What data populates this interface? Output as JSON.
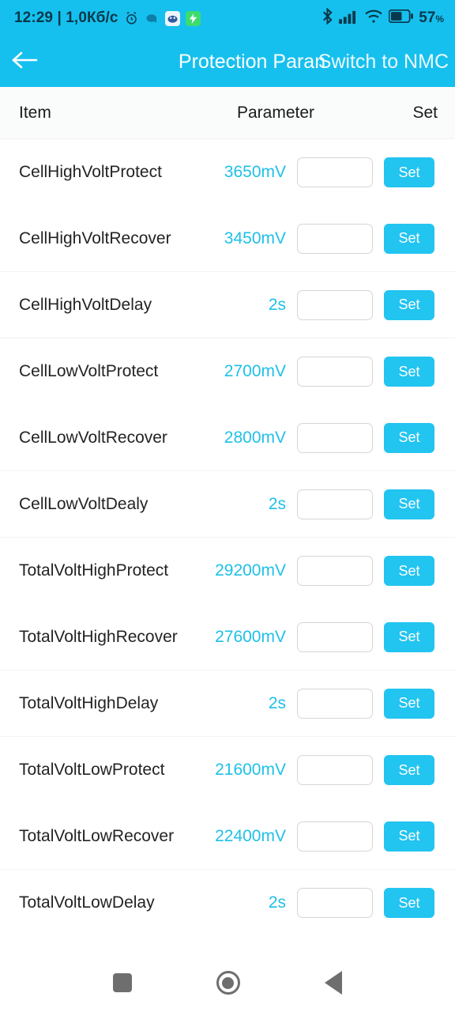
{
  "status_bar": {
    "clock": "12:29 | 1,0Кб/c",
    "battery_percent": "57",
    "percent_symbol": "%",
    "icons": [
      "alarm-clock-icon",
      "app-icon-elephant",
      "app-icon-blue",
      "charging-bolt-icon",
      "bluetooth-icon",
      "cellular-signal-icon",
      "wifi-icon",
      "battery-icon"
    ],
    "accent": "#16C0EE"
  },
  "title_bar": {
    "back_icon": "back-arrow-icon",
    "title": "Protection Paran",
    "overlay_title": "Switch to NMC"
  },
  "columns": {
    "item": "Item",
    "parameter": "Parameter",
    "set": "Set"
  },
  "colors": {
    "accent": "#16C0EE",
    "value_text": "#1fc0e8",
    "button": "#22C4F0",
    "item_text": "#232323"
  },
  "input_placeholder": "",
  "set_label": "Set",
  "rows": [
    {
      "item": "CellHighVoltProtect",
      "value": "3650mV",
      "input": "",
      "button": "Set",
      "sep": false
    },
    {
      "item": "CellHighVoltRecover",
      "value": "3450mV",
      "input": "",
      "button": "Set",
      "sep": true
    },
    {
      "item": "CellHighVoltDelay",
      "value": "2s",
      "input": "",
      "button": "Set",
      "sep": true
    },
    {
      "item": "CellLowVoltProtect",
      "value": "2700mV",
      "input": "",
      "button": "Set",
      "sep": false
    },
    {
      "item": "CellLowVoltRecover",
      "value": "2800mV",
      "input": "",
      "button": "Set",
      "sep": true
    },
    {
      "item": "CellLowVoltDealy",
      "value": "2s",
      "input": "",
      "button": "Set",
      "sep": true
    },
    {
      "item": "TotalVoltHighProtect",
      "value": "29200mV",
      "input": "",
      "button": "Set",
      "sep": false
    },
    {
      "item": "TotalVoltHighRecover",
      "value": "27600mV",
      "input": "",
      "button": "Set",
      "sep": true
    },
    {
      "item": "TotalVoltHighDelay",
      "value": "2s",
      "input": "",
      "button": "Set",
      "sep": true
    },
    {
      "item": "TotalVoltLowProtect",
      "value": "21600mV",
      "input": "",
      "button": "Set",
      "sep": false
    },
    {
      "item": "TotalVoltLowRecover",
      "value": "22400mV",
      "input": "",
      "button": "Set",
      "sep": true
    },
    {
      "item": "TotalVoltLowDelay",
      "value": "2s",
      "input": "",
      "button": "Set",
      "sep": false
    }
  ],
  "nav_bar": {
    "recents": "recents-square-icon",
    "home": "home-circle-icon",
    "back": "back-triangle-icon"
  }
}
